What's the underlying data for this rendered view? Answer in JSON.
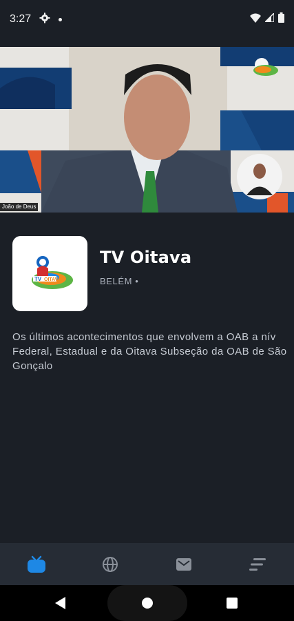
{
  "status_bar": {
    "time": "3:27"
  },
  "video": {
    "speaker_name": "João de Deus"
  },
  "channel": {
    "name": "TV Oitava",
    "location": "BELÉM •",
    "description": "Os últimos acontecimentos que envolvem a OAB a nív\nFederal, Estadual e da Oitava Subseção da OAB de São\nGonçalo"
  },
  "bottom_nav": {
    "active_color": "#1e88e5",
    "inactive_color": "#8a9099",
    "items": [
      "tv-icon",
      "globe-icon",
      "mail-icon",
      "menu-icon"
    ]
  }
}
